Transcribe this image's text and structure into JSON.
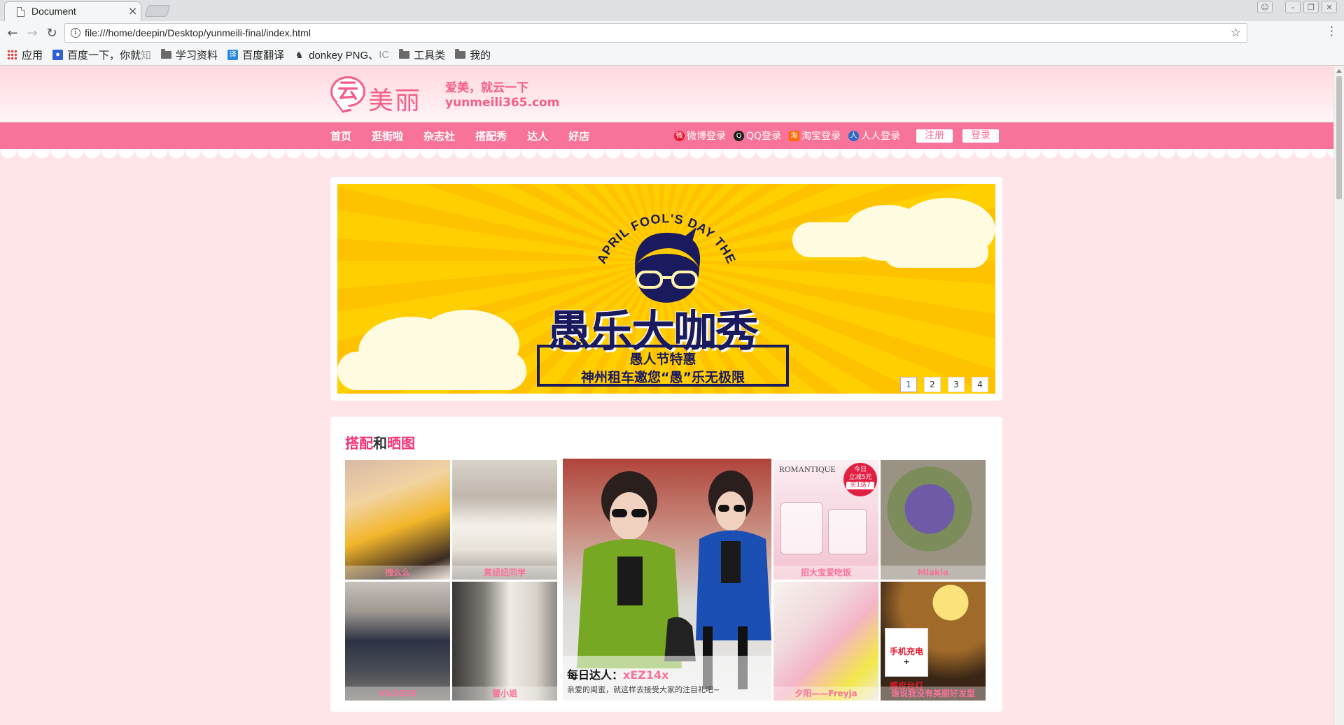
{
  "browser": {
    "tab_title": "Document",
    "tab_close": "×",
    "url": "file:///home/deepin/Desktop/yunmeili-final/index.html",
    "bookmarks": [
      {
        "label": "应用",
        "icon": "apps-icon"
      },
      {
        "label": "百度一下，你就",
        "faded": "知",
        "icon": "baidu-paw-icon"
      },
      {
        "label": "学习资料",
        "icon": "folder-icon"
      },
      {
        "label": "百度翻译",
        "icon": "baidu-translate-icon"
      },
      {
        "label": "donkey PNG、",
        "faded": "IC",
        "icon": "donkey-icon"
      },
      {
        "label": "工具类",
        "icon": "folder-icon"
      },
      {
        "label": "我的",
        "icon": "folder-icon"
      }
    ]
  },
  "header": {
    "logo_bubble": "云",
    "logo_text": "美丽",
    "slogan_line1": "爱美，就云一下",
    "slogan_line2": "yunmeili365.com"
  },
  "nav": {
    "items": [
      "首页",
      "逛街啦",
      "杂志社",
      "搭配秀",
      "达人",
      "好店"
    ],
    "logins": [
      {
        "label": "微博登录",
        "icon": "weibo-icon"
      },
      {
        "label": "QQ登录",
        "icon": "qq-icon"
      },
      {
        "label": "淘宝登录",
        "icon": "taobao-icon"
      },
      {
        "label": "人人登录",
        "icon": "renren-icon"
      }
    ],
    "register": "注册",
    "login": "登录"
  },
  "banner": {
    "arc_text": "APRIL FOOL'S DAY THEME PARTY",
    "title": "愚乐大咖秀",
    "sub1": "愚人节特惠",
    "sub2": "神州租车邀您“愚”乐无极限",
    "pages": [
      "1",
      "2",
      "3",
      "4"
    ],
    "active_page": "1"
  },
  "gallery": {
    "title_part1": "搭配",
    "title_part2": "和",
    "title_part3": "晒图",
    "tiles": [
      "拽么么",
      "黄妞妞同学",
      "Vic2029",
      "蕾小姐",
      "招大宝爱吃饭",
      "Mlakia",
      "夕阳——Freyja",
      "谁说我没有美丽好发型"
    ],
    "feature_label": "每日达人：",
    "feature_user": "xEZ14x",
    "feature_desc": "亲爱的闺蜜，就这样去接受大家的注目礼吧~",
    "perfume_badge_1": "今日",
    "perfume_badge_2": "立减5元",
    "perfume_badge_3": "买1送7",
    "perfume_brand": "ROMANTIQUE",
    "lamp_label_1": "手机充电",
    "lamp_label_2": "+",
    "lamp_label_3": "感应台灯"
  }
}
